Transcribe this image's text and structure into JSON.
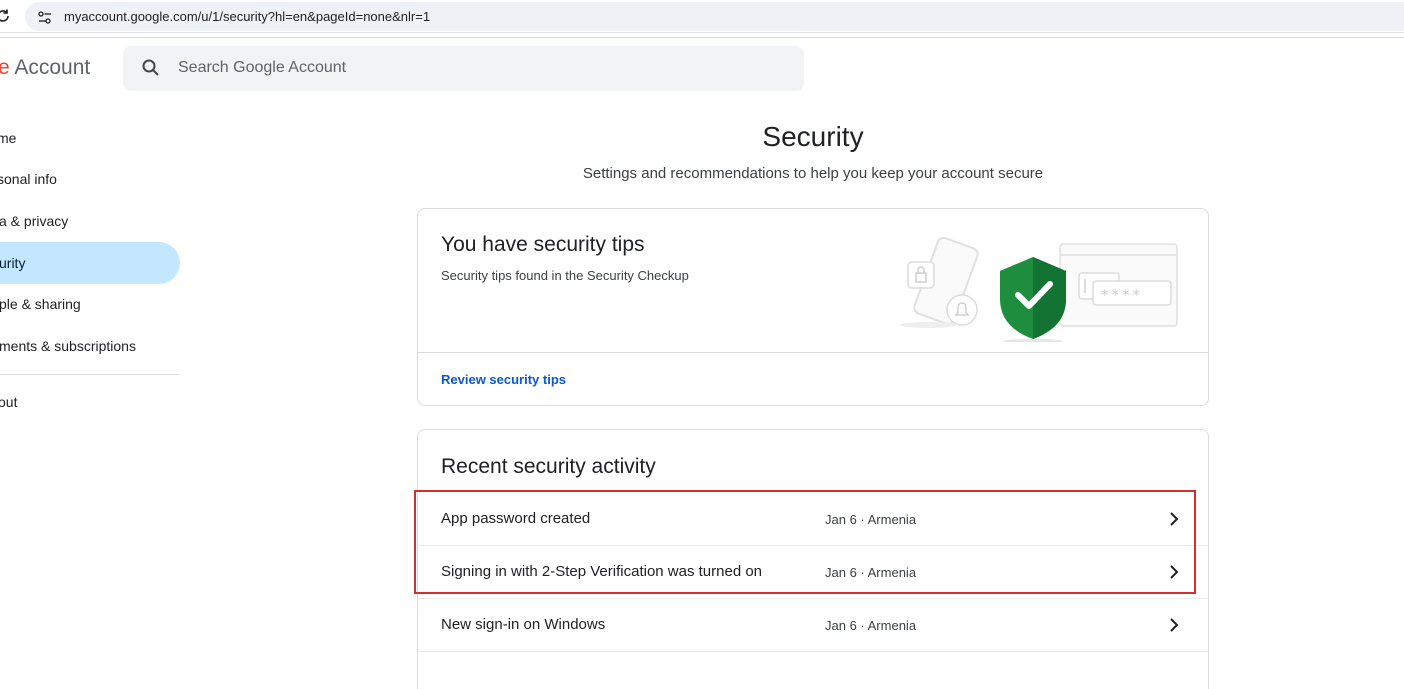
{
  "browser": {
    "url": "myaccount.google.com/u/1/security?hl=en&pageId=none&nlr=1",
    "reload_icon": "reload-icon",
    "site_settings_icon": "tune-icon"
  },
  "header": {
    "brand_partial": "e",
    "brand_word": "Account",
    "search": {
      "placeholder": "Search Google Account",
      "icon": "search-icon"
    }
  },
  "sidebar": {
    "items": [
      {
        "label": "me"
      },
      {
        "label": "sonal info"
      },
      {
        "label": "a & privacy"
      },
      {
        "label": "urity",
        "active": true
      },
      {
        "label": "ple & sharing"
      },
      {
        "label": "ments & subscriptions"
      },
      {
        "label": "out"
      }
    ]
  },
  "main": {
    "title": "Security",
    "subtitle": "Settings and recommendations to help you keep your account secure",
    "tips_card": {
      "title": "You have security tips",
      "subtitle": "Security tips found in the Security Checkup",
      "link": "Review security tips",
      "illustration": "shield-check-icon",
      "mask_text": "****"
    },
    "activity_card": {
      "title": "Recent security activity",
      "rows": [
        {
          "label": "App password created",
          "meta": "Jan 6 · Armenia"
        },
        {
          "label": "Signing in with 2-Step Verification was turned on",
          "meta": "Jan 6 · Armenia"
        },
        {
          "label": "New sign-in on Windows",
          "meta": "Jan 6 · Armenia"
        }
      ]
    }
  },
  "colors": {
    "accent_link": "#0b57d0",
    "nav_active": "#c2e7ff",
    "shield": "#1e8e3e",
    "highlight": "#d32f2f"
  }
}
